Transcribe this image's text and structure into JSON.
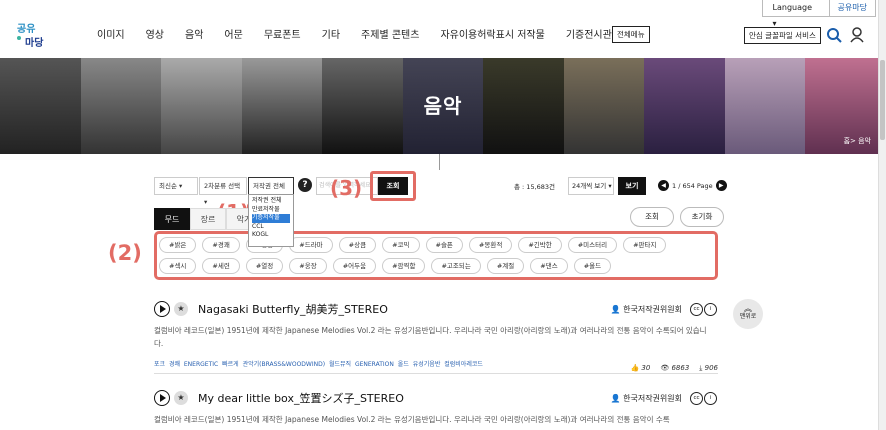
{
  "util": {
    "language": "Language",
    "login": "공유마당"
  },
  "logo": {
    "text": "공유마당"
  },
  "nav": [
    "이미지",
    "영상",
    "음악",
    "어문",
    "무료폰트",
    "기타",
    "주제별 콘텐츠",
    "자유이용허락표시 저작물",
    "기증전시관"
  ],
  "allmenu": "전체메뉴",
  "safe_service": "안심 글꼴파일 서비스",
  "hero": {
    "title": "음악",
    "breadcrumb": "홈> 음악"
  },
  "filters": {
    "sort": "최신순",
    "category": "2차분류 선택",
    "license": "저작권 전체",
    "search_placeholder": "검색어를 입력하세요",
    "search_btn": "조회",
    "total": "총 : 15,683건",
    "per_page": "24개씩 보기",
    "view_btn": "보기",
    "page": "1 / 654 Page"
  },
  "license_options": [
    "저작권 전체",
    "만료저작물",
    "기증저작물",
    "CCL",
    "KOGL"
  ],
  "tabs": [
    "무드",
    "장르",
    "악기"
  ],
  "right_buttons": {
    "search": "조회",
    "reset": "초기화"
  },
  "tags": [
    "#밝은",
    "#경쾌",
    "#엉뚱",
    "#드라마",
    "#상큼",
    "#코믹",
    "#슬픈",
    "#몽환적",
    "#긴박한",
    "#미스터리",
    "#판타지",
    "#섹시",
    "#세련",
    "#열정",
    "#웅장",
    "#어두움",
    "#깜찍함",
    "#고조되는",
    "#계절",
    "#댄스",
    "#올드"
  ],
  "annotations": {
    "a1": "(1)",
    "a2": "(2)",
    "a3": "(3)"
  },
  "items": [
    {
      "title": "Nagasaki Butterfly_胡美芳_STEREO",
      "owner": "한국저작권위원회",
      "desc": "컬럼비아 레코드(일본) 1951년에 제작한 Japanese Melodies Vol.2 라는 유성기음반입니다. 우리나라 국민 아리랑(아리랑의 노래)과 여러나라의 전통 음악이 수록되어 있습니다.",
      "keywords": "포크 경쾌 ENERGETIC 빠르게 관악기(BRASS&WOODWIND) 월드뮤직 GENERATION 올드 유성기음반 컬럼비아레코드",
      "likes": "30",
      "views": "6863",
      "downloads": "906"
    },
    {
      "title": "My dear little box_笠置シズ子_STEREO",
      "owner": "한국저작권위원회",
      "desc": "컬럼비아 레코드(일본) 1951년에 제작한 Japanese Melodies Vol.2 라는 유성기음반입니다. 우리나라 국민 아리랑(아리랑의 노래)과 여러나라의 전통 음악이 수록"
    }
  ],
  "float_btn": "맨위로"
}
